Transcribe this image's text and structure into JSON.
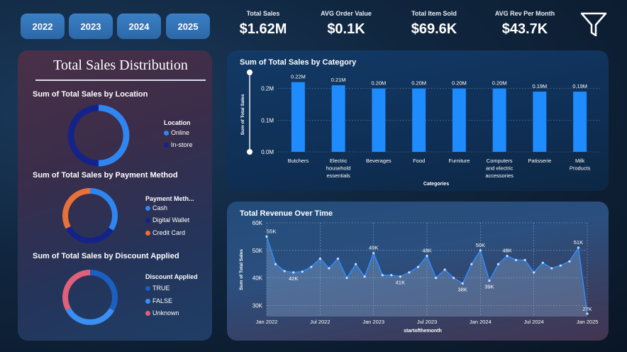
{
  "years": [
    "2022",
    "2023",
    "2024",
    "2025"
  ],
  "kpis": [
    {
      "label": "Total Sales",
      "value": "$1.62M"
    },
    {
      "label": "AVG Order Value",
      "value": "$0.1K"
    },
    {
      "label": "Total Item Sold",
      "value": "$69.6K"
    },
    {
      "label": "AVG Rev Per Month",
      "value": "$43.7K"
    }
  ],
  "filter_icon": "filter-funnel-icon",
  "left_panel": {
    "title": "Total Sales Distribution",
    "location": {
      "title": "Sum of Total Sales by Location",
      "legend_title": "Location",
      "items": [
        {
          "label": "Online",
          "value": 0.5,
          "color": "#2f86f0"
        },
        {
          "label": "In-store",
          "value": 0.5,
          "color": "#13238a"
        }
      ]
    },
    "payment": {
      "title": "Sum of Total Sales by Payment Method",
      "legend_title": "Payment Meth...",
      "items": [
        {
          "label": "Cash",
          "value": 0.34,
          "color": "#2f86f0"
        },
        {
          "label": "Digital Wallet",
          "value": 0.33,
          "color": "#13238a"
        },
        {
          "label": "Credit Card",
          "value": 0.33,
          "color": "#e8713a"
        }
      ]
    },
    "discount": {
      "title": "Sum of Total Sales by Discount Applied",
      "legend_title": "Discount Applied",
      "items": [
        {
          "label": "TRUE",
          "value": 0.33,
          "color": "#1b5fc0"
        },
        {
          "label": "FALSE",
          "value": 0.34,
          "color": "#3a8ff2"
        },
        {
          "label": "Unknown",
          "value": 0.33,
          "color": "#e0607a"
        }
      ]
    }
  },
  "chart_data": [
    {
      "type": "bar",
      "title": "Sum of Total Sales by Category",
      "xlabel": "Categories",
      "ylabel": "Sum of Total Sales",
      "categories": [
        "Butchers",
        "Electric household essentials",
        "Beverages",
        "Food",
        "Furniture",
        "Computers and electric accessories",
        "Patisserie",
        "Milk Products"
      ],
      "values": [
        0.22,
        0.21,
        0.2,
        0.2,
        0.2,
        0.2,
        0.19,
        0.19
      ],
      "data_labels": [
        "0.22M",
        "0.21M",
        "0.20M",
        "0.20M",
        "0.20M",
        "0.20M",
        "0.19M",
        "0.19M"
      ],
      "y_ticks": [
        "0.0M",
        "0.1M",
        "0.2M"
      ],
      "y_tick_values": [
        0,
        0.1,
        0.2
      ],
      "ylim": [
        0,
        0.235
      ],
      "color": "#1e8bff",
      "grid": true
    },
    {
      "type": "area",
      "title": "Total Revenue Over Time",
      "xlabel": "startofthemonth",
      "ylabel": "Sum of Total Sales",
      "x": [
        "2022-01",
        "2022-02",
        "2022-03",
        "2022-04",
        "2022-05",
        "2022-06",
        "2022-07",
        "2022-08",
        "2022-09",
        "2022-10",
        "2022-11",
        "2022-12",
        "2023-01",
        "2023-02",
        "2023-03",
        "2023-04",
        "2023-05",
        "2023-06",
        "2023-07",
        "2023-08",
        "2023-09",
        "2023-10",
        "2023-11",
        "2023-12",
        "2024-01",
        "2024-02",
        "2024-03",
        "2024-04",
        "2024-05",
        "2024-06",
        "2024-07",
        "2024-08",
        "2024-09",
        "2024-10",
        "2024-11",
        "2024-12",
        "2025-01"
      ],
      "values": [
        55,
        45,
        42.5,
        42,
        42.3,
        44,
        47,
        43.5,
        47,
        40,
        45,
        40.5,
        49,
        41,
        41,
        40.5,
        42,
        44,
        48,
        40,
        43,
        40,
        38,
        45,
        50,
        39,
        45,
        48,
        46.5,
        46.5,
        42,
        45.5,
        43.5,
        44.5,
        46,
        51,
        27
      ],
      "y_ticks": [
        "30K",
        "40K",
        "50K",
        "60K"
      ],
      "y_tick_values": [
        30,
        40,
        50,
        60
      ],
      "ylim": [
        26,
        60
      ],
      "x_ticks": [
        "Jan 2022",
        "Jul 2022",
        "Jan 2023",
        "Jul 2023",
        "Jan 2024",
        "Jul 2024",
        "Jan 2025"
      ],
      "x_tick_index": [
        0,
        6,
        12,
        18,
        24,
        30,
        36
      ],
      "annotations": [
        {
          "i": 0,
          "label": "55K"
        },
        {
          "i": 3,
          "label": "42K"
        },
        {
          "i": 12,
          "label": "49K"
        },
        {
          "i": 15,
          "label": "41K"
        },
        {
          "i": 18,
          "label": "48K"
        },
        {
          "i": 22,
          "label": "38K"
        },
        {
          "i": 24,
          "label": "50K"
        },
        {
          "i": 25,
          "label": "39K"
        },
        {
          "i": 27,
          "label": "48K"
        },
        {
          "i": 35,
          "label": "51K"
        },
        {
          "i": 36,
          "label": "27K"
        }
      ],
      "color": "#2a8cff",
      "grid": true
    }
  ]
}
